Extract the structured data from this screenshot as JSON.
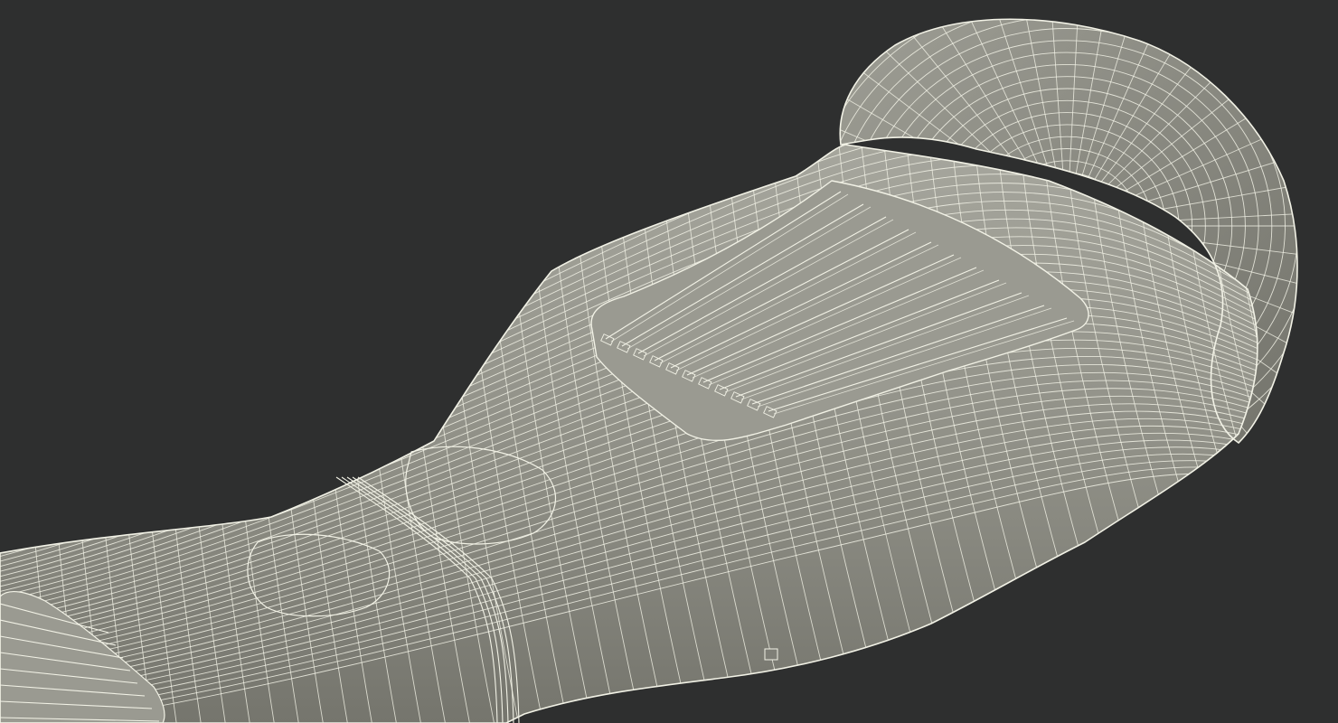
{
  "scene": {
    "subject": "hoverboard-wireframe-render",
    "colors": {
      "background": "#2e2f2f",
      "body_fill": "#8f8f86",
      "body_fill_light": "#a3a39a",
      "body_fill_dark": "#6e6e66",
      "wire": "#f2f2e6"
    }
  }
}
